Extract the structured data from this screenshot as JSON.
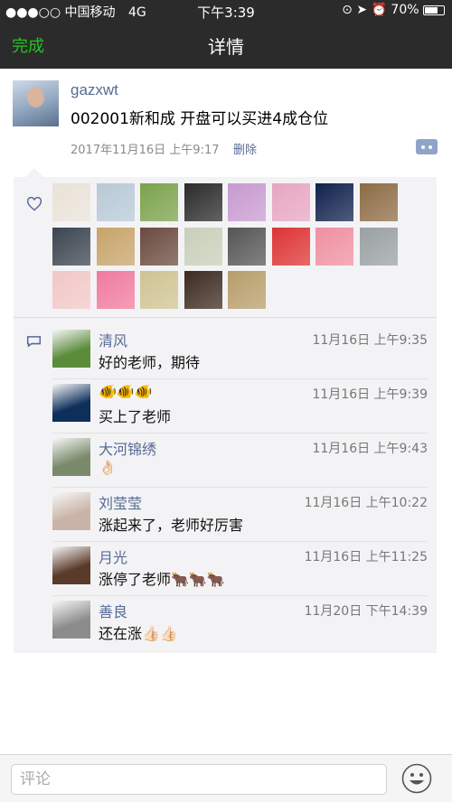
{
  "status_bar": {
    "carrier": "●●●○○ 中国移动",
    "network": "4G",
    "time": "下午3:39",
    "battery": "70%"
  },
  "nav": {
    "back_label": "完成",
    "title": "详情"
  },
  "post": {
    "username": "gazxwt",
    "text": "002001新和成 开盘可以买进4成仓位",
    "time": "2017年11月16日 上午9:17",
    "delete_label": "删除"
  },
  "likes": {
    "colors": [
      "#e9e2d8",
      "#b7c9d6",
      "#7aa24a",
      "#2a2a2a",
      "#c79ad0",
      "#e7a5c2",
      "#10214d",
      "#8e6b45",
      "#3b4450",
      "#c7a36a",
      "#6a4a3e",
      "#c8cfb9",
      "#555555",
      "#d33",
      "#ef8fa0",
      "#9aa0a3",
      "#f2c7c7",
      "#f07a9e",
      "#cfc392",
      "#3c2a20",
      "#b79d6a"
    ]
  },
  "comments": [
    {
      "name": "清风",
      "time": "11月16日 上午9:35",
      "text": "好的老师，期待",
      "color": "#5a8c3a"
    },
    {
      "name": "🐠🐠🐠",
      "time": "11月16日 上午9:39",
      "text": "买上了老师",
      "color": "#0e2f5a"
    },
    {
      "name": "大河锦绣",
      "time": "11月16日 上午9:43",
      "text": "👌🏻",
      "color": "#7a8a6a"
    },
    {
      "name": "刘莹莹",
      "time": "11月16日 上午10:22",
      "text": "涨起来了，老师好厉害",
      "color": "#c9b3a8"
    },
    {
      "name": "月光",
      "time": "11月16日 上午11:25",
      "text": "涨停了老师🐂🐂🐂",
      "color": "#5a3a2a"
    },
    {
      "name": "善良",
      "time": "11月20日 下午14:39",
      "text": "还在涨👍🏻👍🏻",
      "color": "#8c8c8c"
    }
  ],
  "input": {
    "placeholder": "评论"
  }
}
